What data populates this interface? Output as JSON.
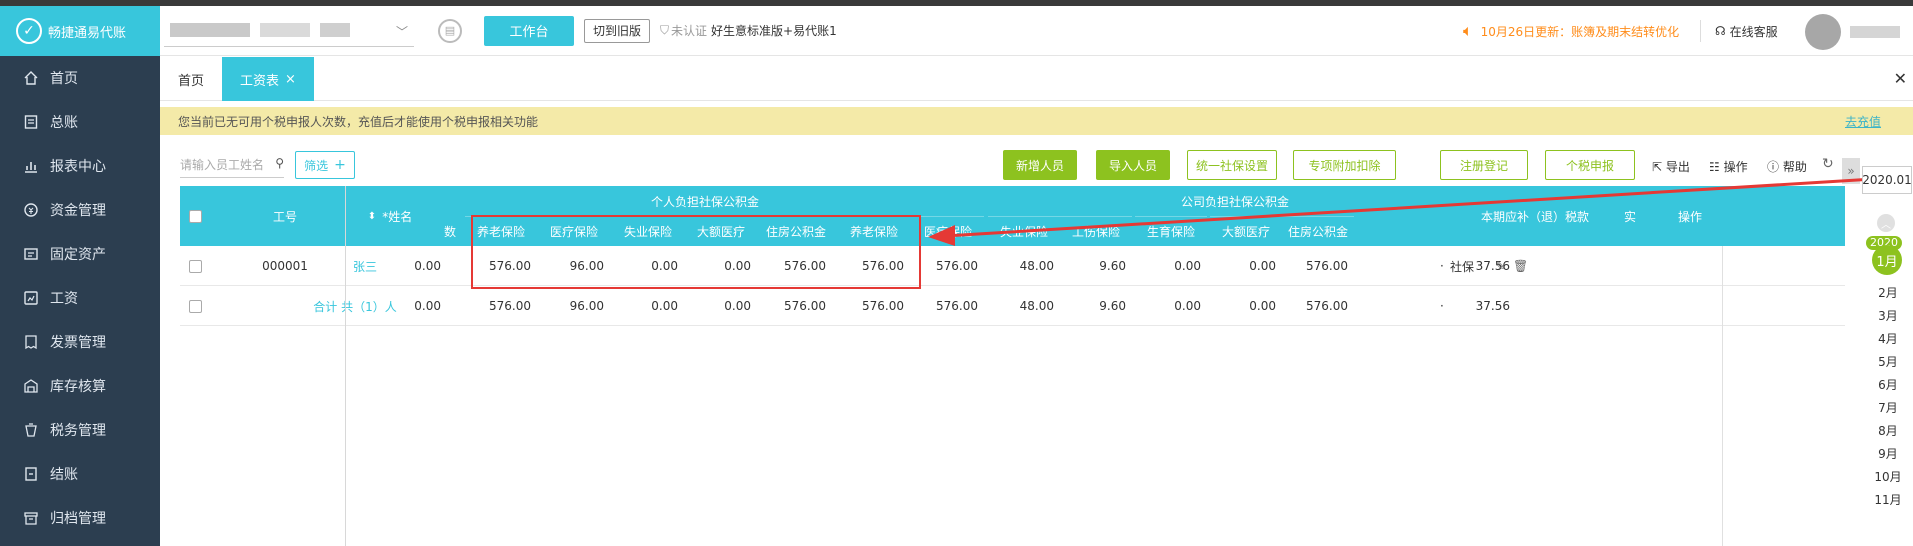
{
  "app": {
    "brand": "畅捷通易代账"
  },
  "colors": {
    "accent": "#38c6dc",
    "green": "#8dc21f",
    "sidebar": "#2c3e50",
    "notice": "#ff8c1a",
    "highlight": "#e53935"
  },
  "sidebar": {
    "items": [
      {
        "label": "首页",
        "icon": "home-icon"
      },
      {
        "label": "总账",
        "icon": "ledger-icon"
      },
      {
        "label": "报表中心",
        "icon": "chart-icon"
      },
      {
        "label": "资金管理",
        "icon": "money-icon"
      },
      {
        "label": "固定资产",
        "icon": "asset-icon"
      },
      {
        "label": "工资",
        "icon": "salary-icon"
      },
      {
        "label": "发票管理",
        "icon": "invoice-icon"
      },
      {
        "label": "库存核算",
        "icon": "warehouse-icon"
      },
      {
        "label": "税务管理",
        "icon": "tax-icon"
      },
      {
        "label": "结账",
        "icon": "close-book-icon"
      },
      {
        "label": "归档管理",
        "icon": "archive-icon"
      }
    ]
  },
  "header": {
    "workbench": "工作台",
    "old_version": "切到旧版",
    "cert": "未认证",
    "plan": "好生意标准版+易代账1",
    "notice": "10月26日更新：账簿及期末结转优化",
    "support": "在线客服"
  },
  "tabs": {
    "home": "首页",
    "active": "工资表",
    "close": "×"
  },
  "warning": {
    "text": "您当前已无可用个税申报人次数，充值后才能使用个税申报相关功能",
    "link": "去充值"
  },
  "toolbar": {
    "search_placeholder": "请输入员工姓名",
    "filter": "筛选",
    "add_person": "新增人员",
    "import_person": "导入人员",
    "social_setting": "统一社保设置",
    "special_deduction": "专项附加扣除",
    "register": "注册登记",
    "tax_declare": "个税申报",
    "export": "导出",
    "operate": "操作",
    "help": "帮助"
  },
  "table": {
    "headers": {
      "id": "工号",
      "name": "*姓名",
      "partial": "数",
      "personal_group": "个人负担社保公积金",
      "company_group": "公司负担社保公积金",
      "tax": "本期应补（退）税款",
      "partial2": "实",
      "ops": "操作",
      "personal": [
        "养老保险",
        "医疗保险",
        "失业保险",
        "大额医疗",
        "住房公积金"
      ],
      "company": [
        "养老保险",
        "医疗保险",
        "失业保险",
        "工伤保险",
        "生育保险",
        "大额医疗",
        "住房公积金"
      ]
    },
    "rows": [
      {
        "id": "000001",
        "name": "张三",
        "partial": "0.00",
        "personal": [
          "576.00",
          "96.00",
          "0.00",
          "0.00",
          "576.00"
        ],
        "company": [
          "576.00",
          "576.00",
          "48.00",
          "9.60",
          "0.00",
          "0.00",
          "576.00"
        ],
        "tax": "37.56",
        "op_label": "社保"
      }
    ],
    "total": {
      "label": "合计 共（1）人",
      "partial": "0.00",
      "personal": [
        "576.00",
        "96.00",
        "0.00",
        "0.00",
        "576.00"
      ],
      "company": [
        "576.00",
        "576.00",
        "48.00",
        "9.60",
        "0.00",
        "0.00",
        "576.00"
      ],
      "tax": "37.56"
    }
  },
  "period": {
    "year_value": "2020.01",
    "year_badge": "2020",
    "active_month": "1月",
    "months": [
      "2月",
      "3月",
      "4月",
      "5月",
      "6月",
      "7月",
      "8月",
      "9月",
      "10月",
      "11月"
    ]
  }
}
